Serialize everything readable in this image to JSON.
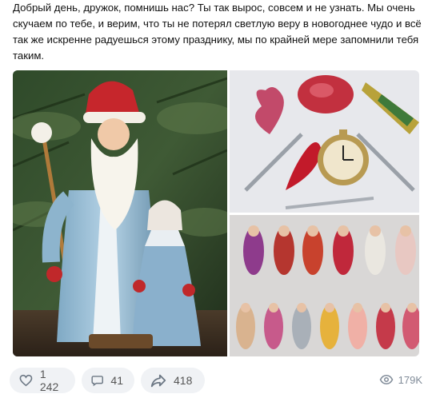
{
  "post": {
    "text": "Добрый день, дружок, помнишь нас? Ты так вырос, совсем и не узнать. Мы очень скучаем по тебе, и верим, что ты не потерял светлую веру в новогоднее чудо и всё так же искренне радуешься этому празднику, мы по крайней мере запомнили тебя таким."
  },
  "actions": {
    "likes": "1 242",
    "comments": "41",
    "shares": "418",
    "views": "179K"
  },
  "icons": {
    "like": "heart-icon",
    "comment": "comment-icon",
    "share": "share-arrow-icon",
    "views": "eye-icon"
  },
  "colors": {
    "pill_bg": "#f0f2f5",
    "icon": "#6d7885",
    "text_secondary": "#818c99"
  }
}
